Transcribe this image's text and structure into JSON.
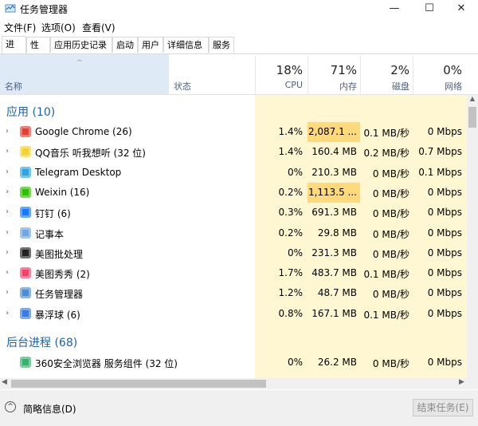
{
  "window": {
    "title": "任务管理器",
    "minimize_glyph": "—",
    "maximize_glyph": "☐",
    "close_glyph": "✕"
  },
  "menu": [
    "文件(F)",
    "选项(O)",
    "查看(V)"
  ],
  "tabs": [
    "进程",
    "性能",
    "应用历史记录",
    "启动",
    "用户",
    "详细信息",
    "服务"
  ],
  "header": {
    "name": "名称",
    "status": "状态",
    "cpu_pct": "18%",
    "cpu": "CPU",
    "mem_pct": "71%",
    "mem": "内存",
    "disk_pct": "2%",
    "disk": "磁盘",
    "net_pct": "0%",
    "net": "网络",
    "sort_glyph": "^"
  },
  "groups": {
    "apps": "应用 (10)",
    "background": "后台进程 (68)"
  },
  "apps": [
    {
      "name": "Google Chrome (26)",
      "cpu": "1.4%",
      "mem": "2,087.1 ...",
      "disk": "0.1 MB/秒",
      "net": "0 Mbps",
      "icon": "chrome-icon",
      "color": "#e34133"
    },
    {
      "name": "QQ音乐 听我想听 (32 位)",
      "cpu": "1.4%",
      "mem": "160.4 MB",
      "disk": "0.2 MB/秒",
      "net": "0.7 Mbps",
      "icon": "qqmusic-icon",
      "color": "#f5d12c"
    },
    {
      "name": "Telegram Desktop",
      "cpu": "0%",
      "mem": "210.3 MB",
      "disk": "0 MB/秒",
      "net": "0.1 Mbps",
      "icon": "telegram-icon",
      "color": "#2ca5e0"
    },
    {
      "name": "Weixin (16)",
      "cpu": "0.2%",
      "mem": "1,113.5 ...",
      "disk": "0 MB/秒",
      "net": "0 Mbps",
      "icon": "weixin-icon",
      "color": "#2dc100"
    },
    {
      "name": "钉钉 (6)",
      "cpu": "0.3%",
      "mem": "691.3 MB",
      "disk": "0 MB/秒",
      "net": "0 Mbps",
      "icon": "dingtalk-icon",
      "color": "#1677ff"
    },
    {
      "name": "记事本",
      "cpu": "0.2%",
      "mem": "29.8 MB",
      "disk": "0 MB/秒",
      "net": "0 Mbps",
      "icon": "notepad-icon",
      "color": "#6fa8dc"
    },
    {
      "name": "美图批处理",
      "cpu": "0%",
      "mem": "231.3 MB",
      "disk": "0 MB/秒",
      "net": "0 Mbps",
      "icon": "meitu-batch-icon",
      "color": "#222222"
    },
    {
      "name": "美图秀秀 (2)",
      "cpu": "1.7%",
      "mem": "483.7 MB",
      "disk": "0.1 MB/秒",
      "net": "0 Mbps",
      "icon": "meitu-icon",
      "color": "#f2426b"
    },
    {
      "name": "任务管理器",
      "cpu": "1.2%",
      "mem": "48.7 MB",
      "disk": "0 MB/秒",
      "net": "0 Mbps",
      "icon": "taskmgr-icon",
      "color": "#4a8fd1"
    },
    {
      "name": "暴浮球 (6)",
      "cpu": "0.8%",
      "mem": "167.1 MB",
      "disk": "0.1 MB/秒",
      "net": "0 Mbps",
      "icon": "floatball-icon",
      "color": "#3a7be0"
    }
  ],
  "background": [
    {
      "name": "360安全浏览器 服务组件 (32 位)",
      "cpu": "0%",
      "mem": "26.2 MB",
      "disk": "0 MB/秒",
      "net": "0 Mbps",
      "icon": "360-browser-icon",
      "color": "#35b36b"
    }
  ],
  "footer": {
    "brief": "简略信息(D)",
    "end_task": "结束任务(E)",
    "collapse_glyph": "^"
  }
}
